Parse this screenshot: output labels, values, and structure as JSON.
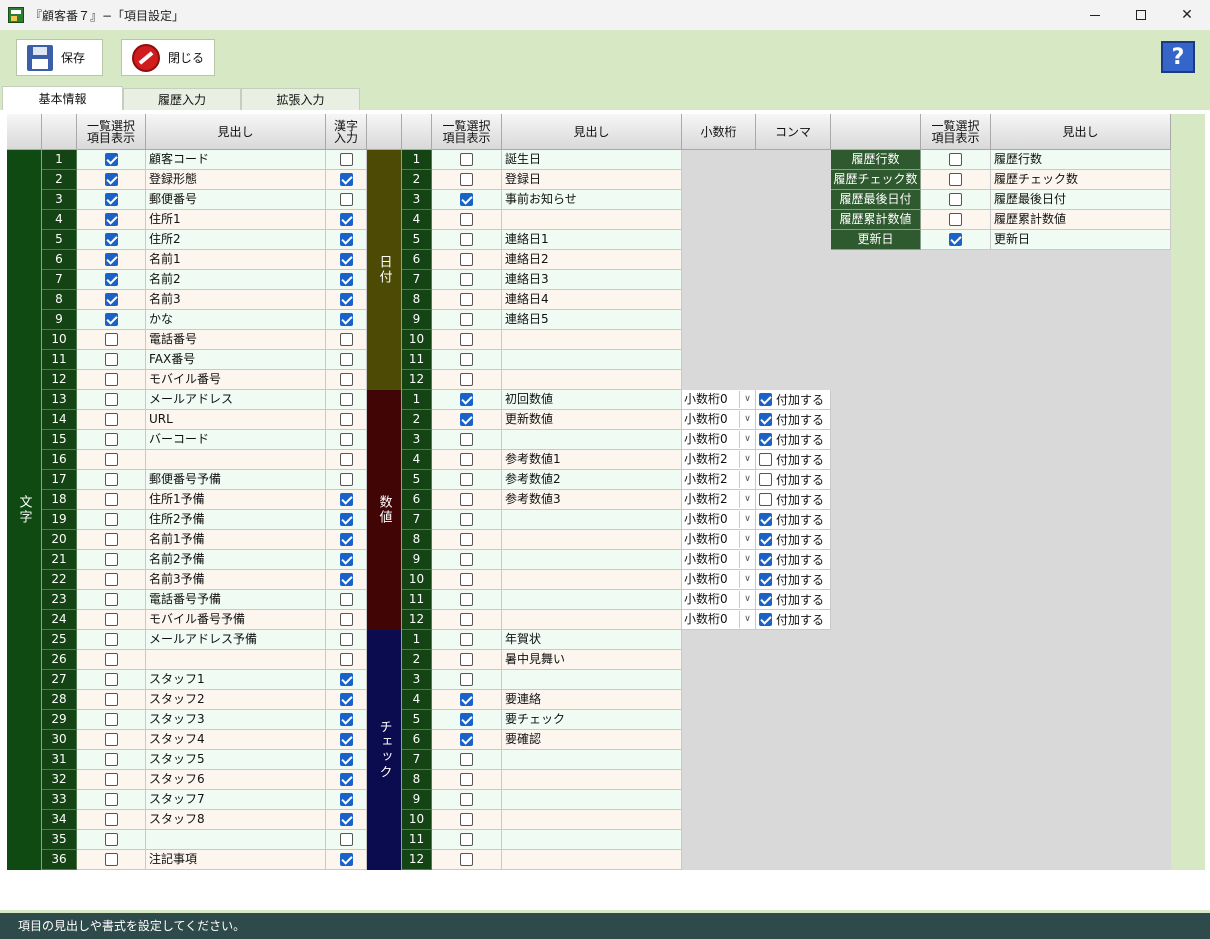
{
  "window": {
    "title": "『顧客番７』−「項目設定」",
    "min": "—",
    "max": "□",
    "close": "✕"
  },
  "toolbar": {
    "save_label": "保存",
    "close_label": "閉じる",
    "help_icon": "?"
  },
  "tabs": [
    "基本情報",
    "履歴入力",
    "拡張入力"
  ],
  "text_section": {
    "group_label": "文字",
    "headers": {
      "list": "一覧選択\n項目表示",
      "heading": "見出し",
      "kanji": "漢字\n入力"
    },
    "rows": [
      {
        "n": "1",
        "list": true,
        "name": "顧客コード",
        "kanji": false
      },
      {
        "n": "2",
        "list": true,
        "name": "登録形態",
        "kanji": true
      },
      {
        "n": "3",
        "list": true,
        "name": "郵便番号",
        "kanji": false
      },
      {
        "n": "4",
        "list": true,
        "name": "住所1",
        "kanji": true
      },
      {
        "n": "5",
        "list": true,
        "name": "住所2",
        "kanji": true
      },
      {
        "n": "6",
        "list": true,
        "name": "名前1",
        "kanji": true
      },
      {
        "n": "7",
        "list": true,
        "name": "名前2",
        "kanji": true
      },
      {
        "n": "8",
        "list": true,
        "name": "名前3",
        "kanji": true
      },
      {
        "n": "9",
        "list": true,
        "name": "かな",
        "kanji": true
      },
      {
        "n": "10",
        "list": false,
        "name": "電話番号",
        "kanji": false
      },
      {
        "n": "11",
        "list": false,
        "name": "FAX番号",
        "kanji": false
      },
      {
        "n": "12",
        "list": false,
        "name": "モバイル番号",
        "kanji": false
      },
      {
        "n": "13",
        "list": false,
        "name": "メールアドレス",
        "kanji": false
      },
      {
        "n": "14",
        "list": false,
        "name": "URL",
        "kanji": false
      },
      {
        "n": "15",
        "list": false,
        "name": "バーコード",
        "kanji": false
      },
      {
        "n": "16",
        "list": false,
        "name": "",
        "kanji": false
      },
      {
        "n": "17",
        "list": false,
        "name": "郵便番号予備",
        "kanji": false
      },
      {
        "n": "18",
        "list": false,
        "name": "住所1予備",
        "kanji": true
      },
      {
        "n": "19",
        "list": false,
        "name": "住所2予備",
        "kanji": true
      },
      {
        "n": "20",
        "list": false,
        "name": "名前1予備",
        "kanji": true
      },
      {
        "n": "21",
        "list": false,
        "name": "名前2予備",
        "kanji": true
      },
      {
        "n": "22",
        "list": false,
        "name": "名前3予備",
        "kanji": true
      },
      {
        "n": "23",
        "list": false,
        "name": "電話番号予備",
        "kanji": false
      },
      {
        "n": "24",
        "list": false,
        "name": "モバイル番号予備",
        "kanji": false
      },
      {
        "n": "25",
        "list": false,
        "name": "メールアドレス予備",
        "kanji": false
      },
      {
        "n": "26",
        "list": false,
        "name": "",
        "kanji": false
      },
      {
        "n": "27",
        "list": false,
        "name": "スタッフ1",
        "kanji": true
      },
      {
        "n": "28",
        "list": false,
        "name": "スタッフ2",
        "kanji": true
      },
      {
        "n": "29",
        "list": false,
        "name": "スタッフ3",
        "kanji": true
      },
      {
        "n": "30",
        "list": false,
        "name": "スタッフ4",
        "kanji": true
      },
      {
        "n": "31",
        "list": false,
        "name": "スタッフ5",
        "kanji": true
      },
      {
        "n": "32",
        "list": false,
        "name": "スタッフ6",
        "kanji": true
      },
      {
        "n": "33",
        "list": false,
        "name": "スタッフ7",
        "kanji": true
      },
      {
        "n": "34",
        "list": false,
        "name": "スタッフ8",
        "kanji": true
      },
      {
        "n": "35",
        "list": false,
        "name": "",
        "kanji": false
      },
      {
        "n": "36",
        "list": false,
        "name": "注記事項",
        "kanji": true
      }
    ]
  },
  "mid_section": {
    "headers": {
      "list": "一覧選択\n項目表示",
      "heading": "見出し",
      "decimals": "小数桁",
      "comma": "コンマ"
    },
    "date_label": "日付",
    "number_label": "数値",
    "check_label": "チェック",
    "comma_label": "付加する",
    "date_rows": [
      {
        "n": "1",
        "list": false,
        "name": "誕生日"
      },
      {
        "n": "2",
        "list": false,
        "name": "登録日"
      },
      {
        "n": "3",
        "list": true,
        "name": "事前お知らせ"
      },
      {
        "n": "4",
        "list": false,
        "name": ""
      },
      {
        "n": "5",
        "list": false,
        "name": "連絡日1"
      },
      {
        "n": "6",
        "list": false,
        "name": "連絡日2"
      },
      {
        "n": "7",
        "list": false,
        "name": "連絡日3"
      },
      {
        "n": "8",
        "list": false,
        "name": "連絡日4"
      },
      {
        "n": "9",
        "list": false,
        "name": "連絡日5"
      },
      {
        "n": "10",
        "list": false,
        "name": ""
      },
      {
        "n": "11",
        "list": false,
        "name": ""
      },
      {
        "n": "12",
        "list": false,
        "name": ""
      }
    ],
    "number_rows": [
      {
        "n": "1",
        "list": true,
        "name": "初回数値",
        "dec": "小数桁0",
        "comma": true
      },
      {
        "n": "2",
        "list": true,
        "name": "更新数値",
        "dec": "小数桁0",
        "comma": true
      },
      {
        "n": "3",
        "list": false,
        "name": "",
        "dec": "小数桁0",
        "comma": true
      },
      {
        "n": "4",
        "list": false,
        "name": "参考数値1",
        "dec": "小数桁2",
        "comma": false
      },
      {
        "n": "5",
        "list": false,
        "name": "参考数値2",
        "dec": "小数桁2",
        "comma": false
      },
      {
        "n": "6",
        "list": false,
        "name": "参考数値3",
        "dec": "小数桁2",
        "comma": false
      },
      {
        "n": "7",
        "list": false,
        "name": "",
        "dec": "小数桁0",
        "comma": true
      },
      {
        "n": "8",
        "list": false,
        "name": "",
        "dec": "小数桁0",
        "comma": true
      },
      {
        "n": "9",
        "list": false,
        "name": "",
        "dec": "小数桁0",
        "comma": true
      },
      {
        "n": "10",
        "list": false,
        "name": "",
        "dec": "小数桁0",
        "comma": true
      },
      {
        "n": "11",
        "list": false,
        "name": "",
        "dec": "小数桁0",
        "comma": true
      },
      {
        "n": "12",
        "list": false,
        "name": "",
        "dec": "小数桁0",
        "comma": true
      }
    ],
    "check_rows": [
      {
        "n": "1",
        "list": false,
        "name": "年賀状"
      },
      {
        "n": "2",
        "list": false,
        "name": "暑中見舞い"
      },
      {
        "n": "3",
        "list": false,
        "name": ""
      },
      {
        "n": "4",
        "list": true,
        "name": "要連絡"
      },
      {
        "n": "5",
        "list": true,
        "name": "要チェック"
      },
      {
        "n": "6",
        "list": true,
        "name": "要確認"
      },
      {
        "n": "7",
        "list": false,
        "name": ""
      },
      {
        "n": "8",
        "list": false,
        "name": ""
      },
      {
        "n": "9",
        "list": false,
        "name": ""
      },
      {
        "n": "10",
        "list": false,
        "name": ""
      },
      {
        "n": "11",
        "list": false,
        "name": ""
      },
      {
        "n": "12",
        "list": false,
        "name": ""
      }
    ]
  },
  "history_section": {
    "headers": {
      "list": "一覧選択\n項目表示",
      "heading": "見出し"
    },
    "rows": [
      {
        "label": "履歴行数",
        "list": false,
        "name": "履歴行数"
      },
      {
        "label": "履歴チェック数",
        "list": false,
        "name": "履歴チェック数"
      },
      {
        "label": "履歴最後日付",
        "list": false,
        "name": "履歴最後日付"
      },
      {
        "label": "履歴累計数値",
        "list": false,
        "name": "履歴累計数値"
      },
      {
        "label": "更新日",
        "list": true,
        "name": "更新日"
      }
    ]
  },
  "status": "項目の見出しや書式を設定してください。",
  "colors": {
    "text_group": "#0e4a12",
    "date_group": "#4d4a06",
    "number_group": "#420505",
    "check_group": "#0b0b4f",
    "accent": "#1a62c8"
  }
}
